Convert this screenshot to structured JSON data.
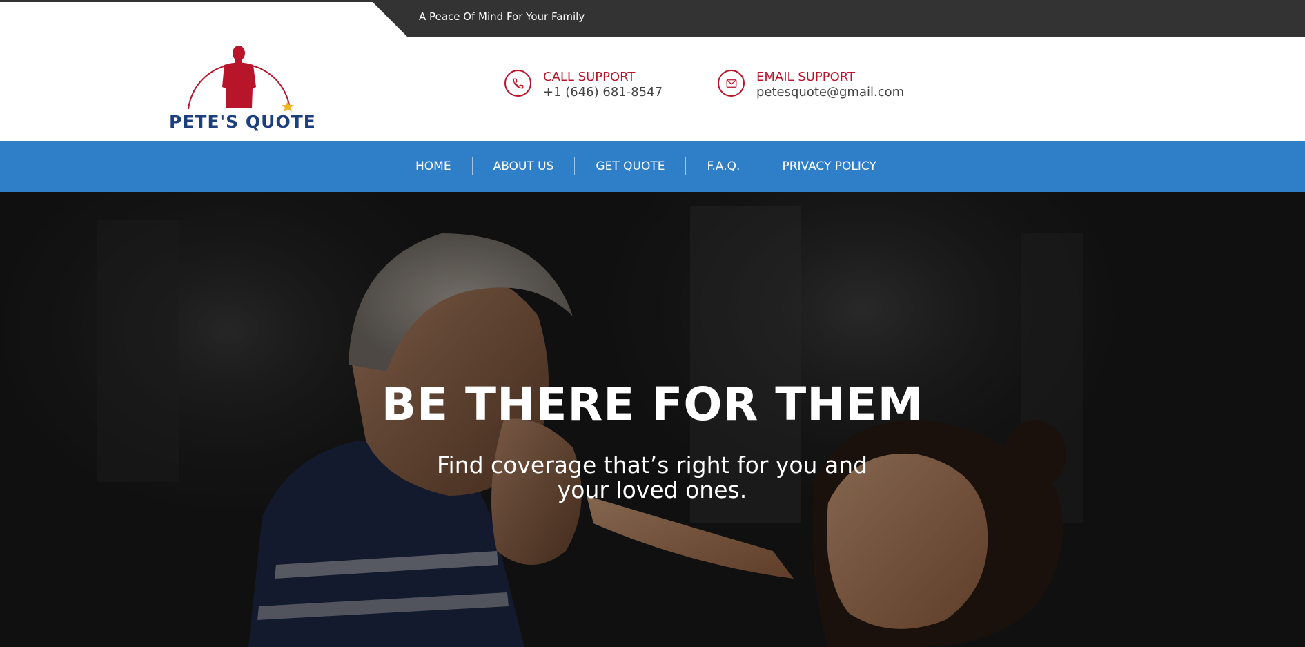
{
  "topbar": {
    "tagline": "A Peace Of Mind For Your Family"
  },
  "logo": {
    "text": "PETE'S QUOTE",
    "colors": {
      "figure": "#b8152a",
      "text": "#1d3f7e",
      "star": "#f0b429"
    }
  },
  "contacts": {
    "call": {
      "icon": "phone-icon",
      "label": "CALL SUPPORT",
      "value": "+1 (646) 681-8547"
    },
    "email": {
      "icon": "envelope-icon",
      "label": "EMAIL SUPPORT",
      "value": "petesquote@gmail.com"
    }
  },
  "nav": {
    "items": [
      {
        "label": "HOME"
      },
      {
        "label": "ABOUT US"
      },
      {
        "label": "GET QUOTE"
      },
      {
        "label": "F.A.Q."
      },
      {
        "label": "PRIVACY POLICY"
      }
    ]
  },
  "hero": {
    "title": "BE THERE FOR THEM",
    "subtitle": "Find coverage that’s right for you and your loved ones."
  },
  "colors": {
    "accent_red": "#b8152a",
    "nav_blue": "#2f7fc8",
    "topbar_dark": "#333333"
  }
}
